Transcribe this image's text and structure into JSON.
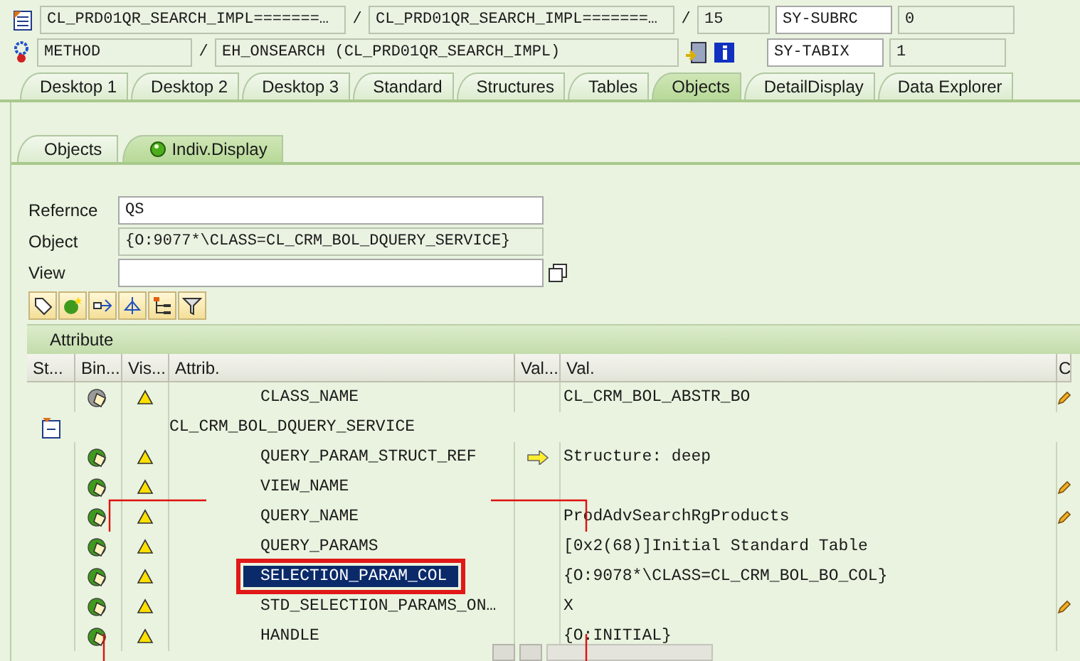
{
  "header": {
    "program": "CL_PRD01QR_SEARCH_IMPL=======…",
    "include": "CL_PRD01QR_SEARCH_IMPL=======…",
    "line": "15",
    "event_type": "METHOD",
    "event": "EH_ONSEARCH (CL_PRD01QR_SEARCH_IMPL)",
    "separators": [
      "/",
      "/",
      "/"
    ]
  },
  "system_fields": [
    {
      "name": "SY-SUBRC",
      "value": "0"
    },
    {
      "name": "SY-TABIX",
      "value": "1"
    }
  ],
  "tabs": [
    {
      "label": "Desktop 1",
      "selected": false
    },
    {
      "label": "Desktop 2",
      "selected": false
    },
    {
      "label": "Desktop 3",
      "selected": false
    },
    {
      "label": "Standard",
      "selected": false
    },
    {
      "label": "Structures",
      "selected": false
    },
    {
      "label": "Tables",
      "selected": false
    },
    {
      "label": "Objects",
      "selected": true
    },
    {
      "label": "DetailDisplay",
      "selected": false
    },
    {
      "label": "Data Explorer",
      "selected": false
    }
  ],
  "subtabs": [
    {
      "label": "Objects",
      "selected": false
    },
    {
      "label": "Indiv.Display",
      "selected": true,
      "kind": "icon"
    }
  ],
  "form": {
    "reference": {
      "label": "Refernce",
      "value": "QS"
    },
    "object": {
      "label": "Object",
      "value": "{O:9077*\\CLASS=CL_CRM_BOL_DQUERY_SERVICE}"
    },
    "view": {
      "label": "View"
    }
  },
  "section_title": "Attribute",
  "table": {
    "columns": [
      "St...",
      "Bin...",
      "Vis...",
      "Attrib.",
      "Val...",
      "Val.",
      "C"
    ],
    "rows": [
      {
        "kind": "static_attribute",
        "name": "CLASS_NAME",
        "value": "CL_CRM_BOL_ABSTR_BO",
        "drill_down": false,
        "editable": true,
        "selected": false
      },
      {
        "kind": "class",
        "name": "CL_CRM_BOL_DQUERY_SERVICE"
      },
      {
        "kind": "attribute",
        "name": "QUERY_PARAM_STRUCT_REF",
        "value": "Structure: deep",
        "drill_down": true,
        "editable": false,
        "selected": false
      },
      {
        "kind": "attribute",
        "name": "VIEW_NAME",
        "drill_down": false,
        "editable": true,
        "selected": false
      },
      {
        "kind": "attribute",
        "name": "QUERY_NAME",
        "value": "ProdAdvSearchRgProducts",
        "drill_down": false,
        "editable": true,
        "selected": false
      },
      {
        "kind": "attribute",
        "name": "QUERY_PARAMS",
        "value": "[0x2(68)]Initial Standard Table",
        "drill_down": false,
        "editable": false,
        "selected": false
      },
      {
        "kind": "attribute",
        "name": "SELECTION_PARAM_COL",
        "value": "{O:9078*\\CLASS=CL_CRM_BOL_BO_COL}",
        "drill_down": false,
        "editable": false,
        "selected": true
      },
      {
        "kind": "attribute",
        "name": "STD_SELECTION_PARAMS_ON…",
        "value": "X",
        "drill_down": false,
        "editable": true,
        "selected": false
      },
      {
        "kind": "attribute",
        "name": "HANDLE",
        "value": "{O:INITIAL}",
        "drill_down": false,
        "editable": false,
        "selected": false
      }
    ]
  }
}
